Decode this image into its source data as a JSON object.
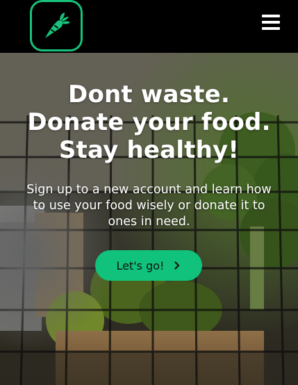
{
  "navbar": {
    "logo_icon": "carrot-icon",
    "menu_icon": "hamburger-menu-icon",
    "accent_color": "#17c27a"
  },
  "hero": {
    "title": "Dont waste. Donate your food. Stay healthy!",
    "subtitle": "Sign up to a new account and learn how to use your food wisely or donate it to ones in need.",
    "cta_label": "Let's go!",
    "cta_icon": "chevron-right-icon",
    "cta_color": "#10c27b",
    "background_image": "groceries-in-wire-basket-photo"
  }
}
